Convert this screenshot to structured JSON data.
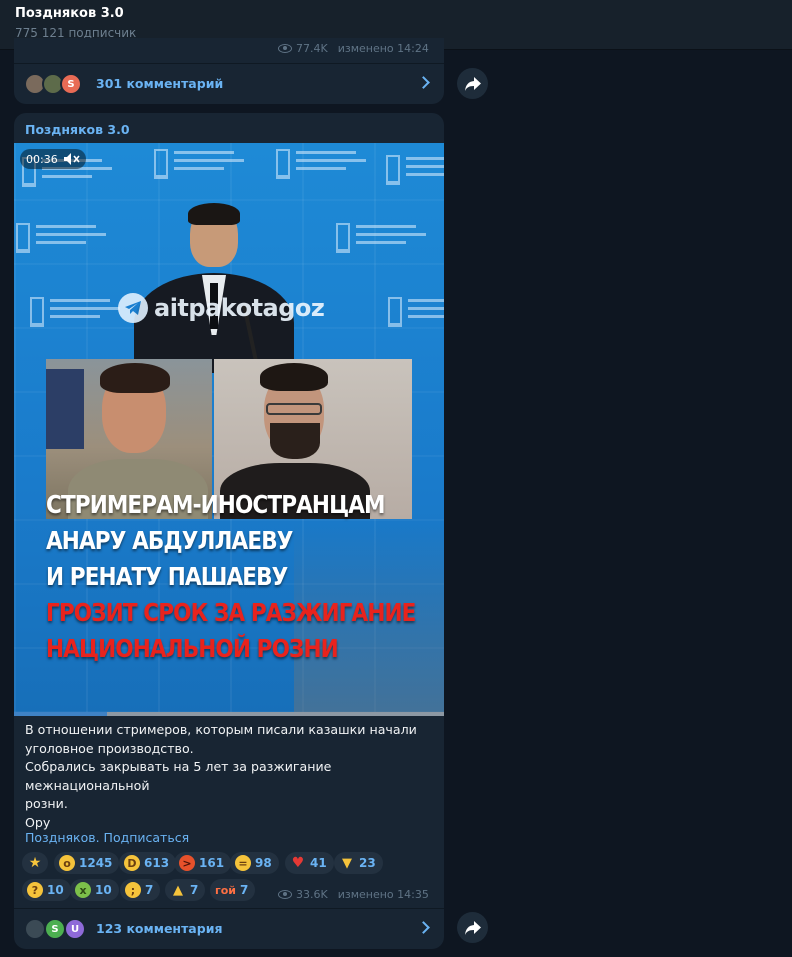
{
  "header": {
    "channel_title": "Поздняков 3.0",
    "subscribers": "775 121 подписчик"
  },
  "post1": {
    "views": "77.4K",
    "edited": "изменено 14:24",
    "avatars": [
      {
        "letter": "",
        "color": "#7a6a5c"
      },
      {
        "letter": "",
        "color": "#5d6b4a"
      },
      {
        "letter": "S",
        "color": "#e86b55"
      }
    ],
    "comments_label": "301 комментарий"
  },
  "post2": {
    "sender": "Поздняков 3.0",
    "video": {
      "timer": "00:36",
      "watermark": "aitpakotagoz",
      "headline_white": [
        "СТРИМЕРАМ-ИНОСТРАНЦАМ",
        "АНАРУ АБДУЛЛАЕВУ",
        "И РЕНАТУ ПАШАЕВУ"
      ],
      "headline_red": [
        "ГРОЗИТ СРОК ЗА РАЗЖИГАНИЕ",
        "НАЦИОНАЛЬНОЙ РОЗНИ"
      ],
      "progress_fraction": 0.217
    },
    "text_lines": [
      "В отношении стримеров, которым писали казашки начали",
      "уголовное производство.",
      "Собрались закрывать на 5 лет за разжигание межнациональной",
      "розни.",
      "Ору"
    ],
    "signature_link": "Поздняков. Подписаться",
    "reactions_row1": [
      {
        "icon": "star-icon",
        "glyph": "★",
        "count": ""
      },
      {
        "icon": "shocked-face-icon",
        "glyph": "😲",
        "count": "1245"
      },
      {
        "icon": "rofl-face-icon",
        "glyph": "🤣",
        "count": "613"
      },
      {
        "icon": "angry-face-icon",
        "glyph": "😡",
        "count": "161"
      },
      {
        "icon": "grin-face-icon",
        "glyph": "😁",
        "count": "98"
      },
      {
        "icon": "heart-icon",
        "glyph": "♥",
        "count": "41"
      },
      {
        "icon": "thumbs-down-icon",
        "glyph": "👎",
        "count": "23"
      }
    ],
    "reactions_row2": [
      {
        "icon": "thinking-face-icon",
        "glyph": "🤔",
        "count": "10"
      },
      {
        "icon": "nauseated-face-icon",
        "glyph": "🤮",
        "count": "10"
      },
      {
        "icon": "crying-face-icon",
        "glyph": "😢",
        "count": "7"
      },
      {
        "icon": "pray-icon",
        "glyph": "🙏",
        "count": "7"
      },
      {
        "icon": "custom-text-emoji-icon",
        "glyph": "гой",
        "count": "7"
      }
    ],
    "views": "33.6K",
    "edited": "изменено 14:35",
    "avatars": [
      {
        "letter": "",
        "color": "#3b4a55"
      },
      {
        "letter": "S",
        "color": "#4caf50"
      },
      {
        "letter": "U",
        "color": "#8e6ad8"
      }
    ],
    "comments_label": "123 комментария"
  }
}
